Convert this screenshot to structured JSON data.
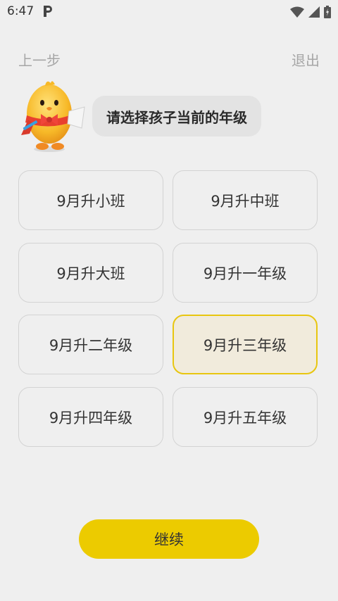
{
  "status_bar": {
    "time": "6:47",
    "icons": [
      "app-p-icon",
      "wifi-icon",
      "cell-signal-icon",
      "battery-icon"
    ]
  },
  "nav": {
    "back_label": "上一步",
    "exit_label": "退出"
  },
  "prompt": {
    "text": "请选择孩子当前的年级"
  },
  "grades": [
    {
      "label": "9月升小班",
      "selected": false
    },
    {
      "label": "9月升中班",
      "selected": false
    },
    {
      "label": "9月升大班",
      "selected": false
    },
    {
      "label": "9月升一年级",
      "selected": false
    },
    {
      "label": "9月升二年级",
      "selected": false
    },
    {
      "label": "9月升三年级",
      "selected": true
    },
    {
      "label": "9月升四年级",
      "selected": false
    },
    {
      "label": "9月升五年级",
      "selected": false
    }
  ],
  "continue_label": "继续",
  "colors": {
    "background": "#efefef",
    "accent": "#eccb00",
    "selected_border": "#e8c610",
    "selected_fill": "#f1ebdc"
  }
}
